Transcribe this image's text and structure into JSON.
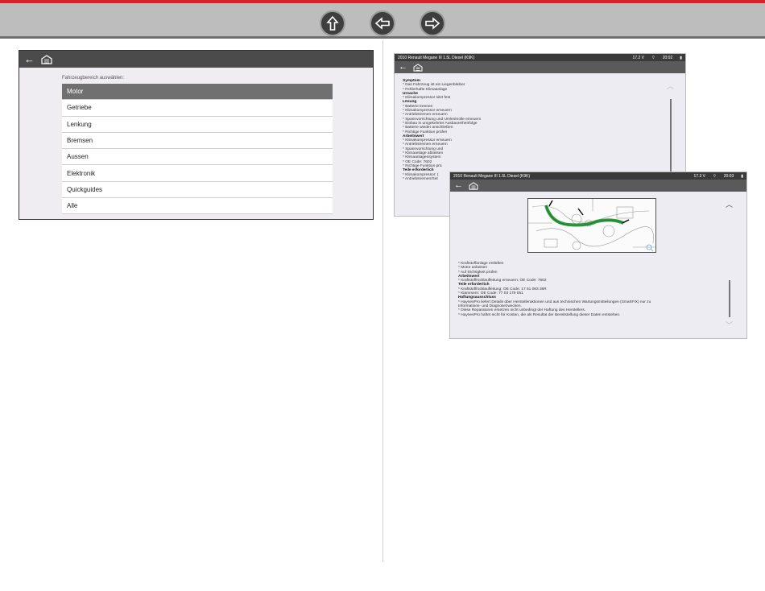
{
  "toolbar": {
    "accent": "#d9222a",
    "buttons": [
      {
        "name": "up",
        "icon": "arrow-up-icon"
      },
      {
        "name": "back",
        "icon": "arrow-left-icon"
      },
      {
        "name": "forward",
        "icon": "arrow-right-icon"
      }
    ]
  },
  "screen1": {
    "label": "Fahrzeugbereich auswählen:",
    "items": [
      "Motor",
      "Getriebe",
      "Lenkung",
      "Bremsen",
      "Aussen",
      "Elektronik",
      "Quickguides",
      "Alle"
    ],
    "active_index": 0
  },
  "screen2": {
    "title": "2010 Renault Megane III 1.5L Diesel (K9K)",
    "voltage": "17.2 V",
    "time": "20:02",
    "lines": [
      {
        "t": "Symptom",
        "h": true
      },
      {
        "t": "* Das Fahrzeug ist ein Liegenbleiber"
      },
      {
        "t": "* Fehlerhafte Klimaanlage"
      },
      {
        "t": "Ursache",
        "h": true
      },
      {
        "t": "* Klimakompressor sitzt fest"
      },
      {
        "t": "Lösung",
        "h": true
      },
      {
        "t": "* Batterie trennen"
      },
      {
        "t": "* Klimakompressor erneuern"
      },
      {
        "t": "* Antriebsriemen erneuern"
      },
      {
        "t": "* Spannvorrichtung und Umlenkrolle erneuern"
      },
      {
        "t": "* Einbau in umgekehrter Ausbaureihenfolge"
      },
      {
        "t": "* Batterie wieder anschließen"
      },
      {
        "t": "* Richtige Funktion prüfen"
      },
      {
        "t": "Arbeitswert",
        "h": true
      },
      {
        "t": "* Klimakompressor erneuern"
      },
      {
        "t": "* Antriebsriemen erneuern"
      },
      {
        "t": "* Spannvorrichtung und"
      },
      {
        "t": "* Klimaanlage ablassen"
      },
      {
        "t": "* Klimaanlagensystem"
      },
      {
        "t": "* OE Code: 7602"
      },
      {
        "t": "* Richtige Funktion prü"
      },
      {
        "t": "Teile erforderlich",
        "h": true
      },
      {
        "t": "* Klimakompressor: ("
      },
      {
        "t": "* Antriebsriemen/Set"
      }
    ]
  },
  "screen3": {
    "title": "2010 Renault Megane III 1.5L Diesel (K9K)",
    "voltage": "17.3 V",
    "time": "20:03",
    "lines": [
      {
        "t": "* Kraftstoffanlage entlüften"
      },
      {
        "t": "* Motor anlassen"
      },
      {
        "t": "* Auf Dichtigkeit prüfen"
      },
      {
        "t": "Arbeitswert",
        "h": true
      },
      {
        "t": "* Kraftstoffrücklaufleitung erneuern: OE Code: 7602"
      },
      {
        "t": "Teile erforderlich",
        "h": true
      },
      {
        "t": "* Kraftstoffrücklaufleitung: OE Code: 17 51 083 36R"
      },
      {
        "t": "* Klammern: OE Code: 77 03 179 051"
      },
      {
        "t": "Haftungsausschluss",
        "h": true
      },
      {
        "t": "* HaynesPro liefert Details über Herstelleraktionen und aus technischen Wartungsmitteilungen (SmartFIX) nur zu"
      },
      {
        "t": "Informations- und Diagnosezwecken."
      },
      {
        "t": "* Diese Reparaturen ersetzen nicht unbedingt der Haftung des Herstellers."
      },
      {
        "t": "* HaynesPro haftet nicht für Kosten, die als Resultat der Bereitstellung dieser Daten entstehen."
      }
    ]
  }
}
